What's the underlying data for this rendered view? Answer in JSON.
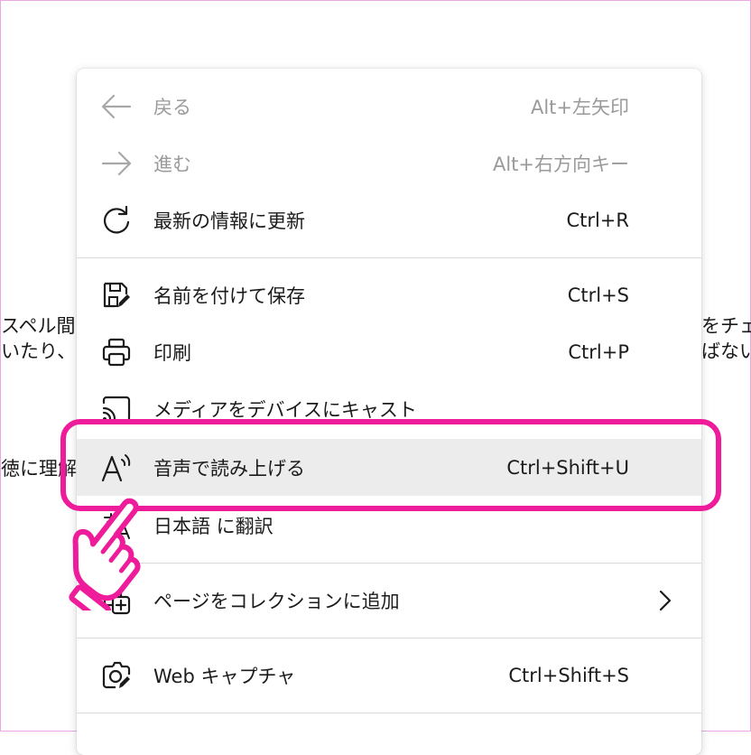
{
  "background": {
    "left_line1": "スペル間",
    "left_line2": "いたり、",
    "left_line3": "徳に理解",
    "right_line1": "をチェ",
    "right_line2": "ばない"
  },
  "menu": {
    "items": [
      {
        "label": "戻る",
        "shortcut": "Alt+左矢印",
        "icon": "arrow-left-icon",
        "disabled": true
      },
      {
        "label": "進む",
        "shortcut": "Alt+右方向キー",
        "icon": "arrow-right-icon",
        "disabled": true
      },
      {
        "label": "最新の情報に更新",
        "shortcut": "Ctrl+R",
        "icon": "refresh-icon"
      },
      {
        "label": "名前を付けて保存",
        "shortcut": "Ctrl+S",
        "icon": "save-as-icon"
      },
      {
        "label": "印刷",
        "shortcut": "Ctrl+P",
        "icon": "printer-icon"
      },
      {
        "label": "メディアをデバイスにキャスト",
        "shortcut": "",
        "icon": "cast-icon"
      },
      {
        "label": "音声で読み上げる",
        "shortcut": "Ctrl+Shift+U",
        "icon": "read-aloud-icon",
        "highlighted": true
      },
      {
        "label": "日本語 に翻訳",
        "shortcut": "",
        "icon": "translate-icon"
      },
      {
        "label": "ページをコレクションに追加",
        "shortcut": "",
        "icon": "add-to-collection-icon",
        "submenu": true
      },
      {
        "label": "Web キャプチャ",
        "shortcut": "Ctrl+Shift+S",
        "icon": "web-capture-icon"
      }
    ]
  },
  "colors": {
    "highlight_frame": "#ee1c9b",
    "hover_background": "#ececec",
    "disabled_text": "#9a9a9a",
    "text": "#1b1b1b"
  }
}
